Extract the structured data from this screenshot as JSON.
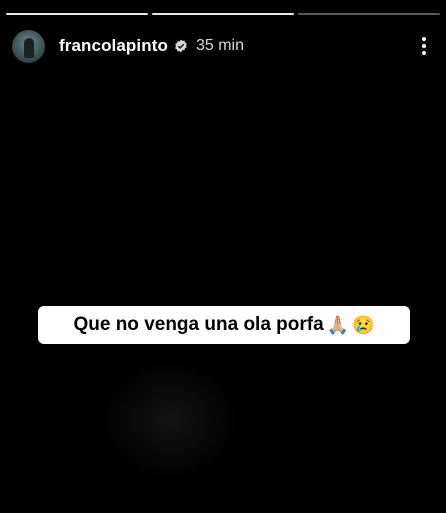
{
  "story": {
    "progress": {
      "segments": 3,
      "completed": 2
    },
    "header": {
      "username": "francolapinto",
      "time": "35 min",
      "verified": true,
      "more_icon": "more-vertical-icon"
    },
    "caption": {
      "text": "Que no venga una ola porfa",
      "emoji_1": "🙏🏼",
      "emoji_2": "😢"
    }
  }
}
